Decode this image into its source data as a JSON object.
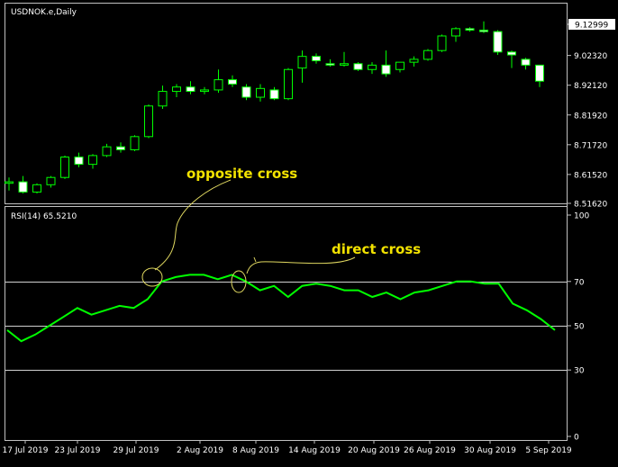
{
  "chart": {
    "symbol_label": "USDNOK.e,Daily",
    "rsi_label": "RSI(14) 65.5210",
    "current_price": "9.12999",
    "colors": {
      "background": "#000000",
      "frame": "#c0c0c0",
      "bull": "#00ff00",
      "bear": "#ffffff",
      "rsi": "#00ff00",
      "annotation": "#f2e200",
      "annotation_line": "#e0d860"
    },
    "annotations": [
      "opposite cross",
      "direct cross"
    ]
  },
  "chart_data": [
    {
      "type": "candlestick",
      "title": "USDNOK.e,Daily",
      "ylim": [
        8.5162,
        9.12999
      ],
      "y_ticks": [
        "9.12999",
        "9.02320",
        "8.92120",
        "8.81920",
        "8.71720",
        "8.61520",
        "8.51620"
      ],
      "x_ticks": [
        "17 Jul 2019",
        "23 Jul 2019",
        "29 Jul 2019",
        "2 Aug 2019",
        "8 Aug 2019",
        "14 Aug 2019",
        "20 Aug 2019",
        "26 Aug 2019",
        "30 Aug 2019",
        "5 Sep 2019"
      ],
      "ohlc": [
        [
          8.585,
          8.605,
          8.56,
          8.59
        ],
        [
          8.59,
          8.61,
          8.55,
          8.555
        ],
        [
          8.555,
          8.585,
          8.55,
          8.58
        ],
        [
          8.58,
          8.61,
          8.57,
          8.605
        ],
        [
          8.605,
          8.68,
          8.6,
          8.675
        ],
        [
          8.675,
          8.69,
          8.64,
          8.65
        ],
        [
          8.65,
          8.685,
          8.635,
          8.68
        ],
        [
          8.68,
          8.72,
          8.675,
          8.71
        ],
        [
          8.71,
          8.725,
          8.69,
          8.7
        ],
        [
          8.7,
          8.75,
          8.695,
          8.745
        ],
        [
          8.745,
          8.855,
          8.74,
          8.85
        ],
        [
          8.85,
          8.92,
          8.84,
          8.9
        ],
        [
          8.9,
          8.925,
          8.88,
          8.915
        ],
        [
          8.915,
          8.935,
          8.89,
          8.9
        ],
        [
          8.9,
          8.915,
          8.89,
          8.905
        ],
        [
          8.905,
          8.975,
          8.895,
          8.94
        ],
        [
          8.94,
          8.955,
          8.915,
          8.925
        ],
        [
          8.915,
          8.925,
          8.87,
          8.88
        ],
        [
          8.88,
          8.925,
          8.865,
          8.91
        ],
        [
          8.905,
          8.915,
          8.87,
          8.875
        ],
        [
          8.875,
          8.98,
          8.87,
          8.975
        ],
        [
          8.98,
          9.04,
          8.93,
          9.02
        ],
        [
          9.02,
          9.03,
          8.995,
          9.005
        ],
        [
          8.995,
          9.01,
          8.985,
          8.99
        ],
        [
          8.99,
          9.035,
          8.985,
          8.995
        ],
        [
          8.995,
          9.0,
          8.97,
          8.975
        ],
        [
          8.975,
          9.0,
          8.96,
          8.99
        ],
        [
          8.99,
          9.04,
          8.95,
          8.96
        ],
        [
          8.975,
          9.0,
          8.965,
          9.0
        ],
        [
          9.0,
          9.02,
          8.985,
          9.01
        ],
        [
          9.01,
          9.045,
          9.005,
          9.04
        ],
        [
          9.04,
          9.095,
          9.035,
          9.09
        ],
        [
          9.09,
          9.12,
          9.07,
          9.115
        ],
        [
          9.115,
          9.12,
          9.105,
          9.11
        ],
        [
          9.11,
          9.14,
          9.1,
          9.105
        ],
        [
          9.105,
          9.11,
          9.025,
          9.035
        ],
        [
          9.035,
          9.04,
          8.98,
          9.025
        ],
        [
          9.01,
          9.015,
          8.975,
          8.99
        ],
        [
          8.99,
          8.99,
          8.915,
          8.935
        ]
      ]
    },
    {
      "type": "line",
      "title": "RSI(14) 65.5210",
      "ylim": [
        0,
        100
      ],
      "y_ticks": [
        100,
        70,
        50,
        30,
        0
      ],
      "levels": [
        70,
        50,
        30
      ],
      "series": [
        {
          "values": [
            48,
            43,
            46,
            50,
            54,
            58,
            55,
            57,
            59,
            58,
            62,
            70,
            72,
            73,
            73,
            71,
            73,
            70,
            66,
            68,
            63,
            68,
            69,
            68,
            66,
            66,
            63,
            65,
            62,
            65,
            66,
            68,
            70,
            70,
            69,
            69,
            60,
            57,
            53,
            48
          ]
        }
      ]
    }
  ]
}
